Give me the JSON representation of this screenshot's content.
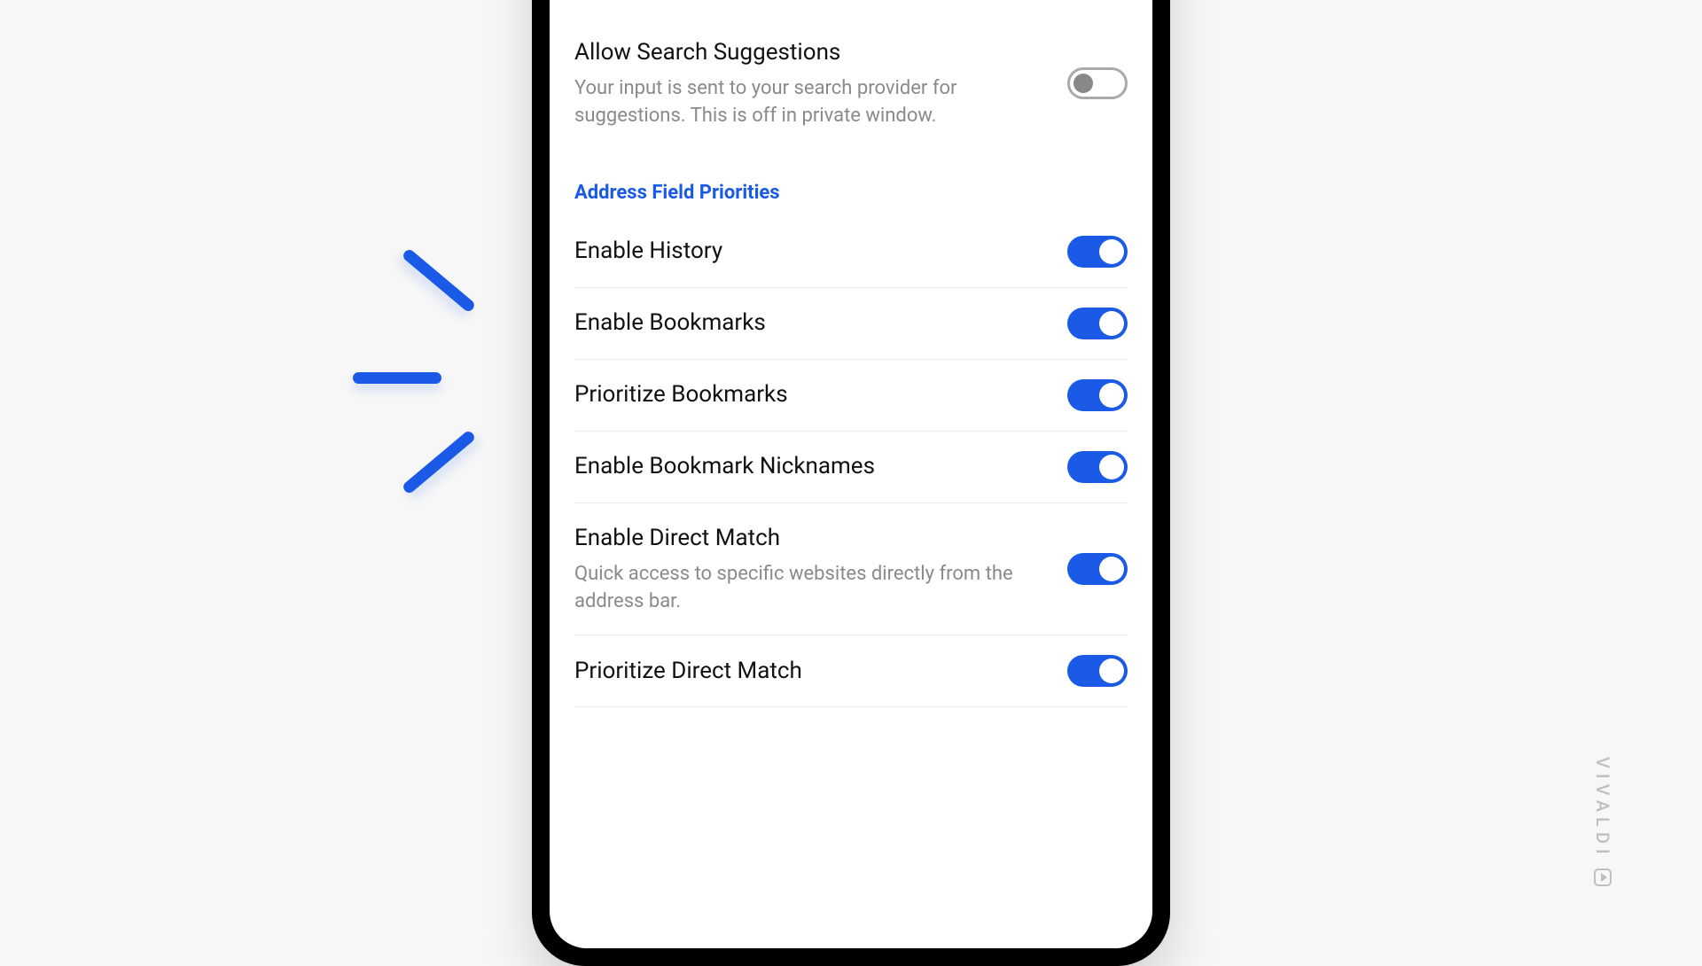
{
  "search_suggestions": {
    "title": "Allow Search Suggestions",
    "description": "Your input is sent to your search provider for suggestions. This is off in private window.",
    "enabled": false
  },
  "section_header": "Address Field Priorities",
  "address_priorities": [
    {
      "title": "Enable History",
      "description": "",
      "enabled": true
    },
    {
      "title": "Enable Bookmarks",
      "description": "",
      "enabled": true
    },
    {
      "title": "Prioritize Bookmarks",
      "description": "",
      "enabled": true
    },
    {
      "title": "Enable Bookmark Nicknames",
      "description": "",
      "enabled": true
    },
    {
      "title": "Enable Direct Match",
      "description": "Quick access to specific websites directly from the address bar.",
      "enabled": true
    },
    {
      "title": "Prioritize Direct Match",
      "description": "",
      "enabled": true
    }
  ],
  "brand": "VIVALDI"
}
